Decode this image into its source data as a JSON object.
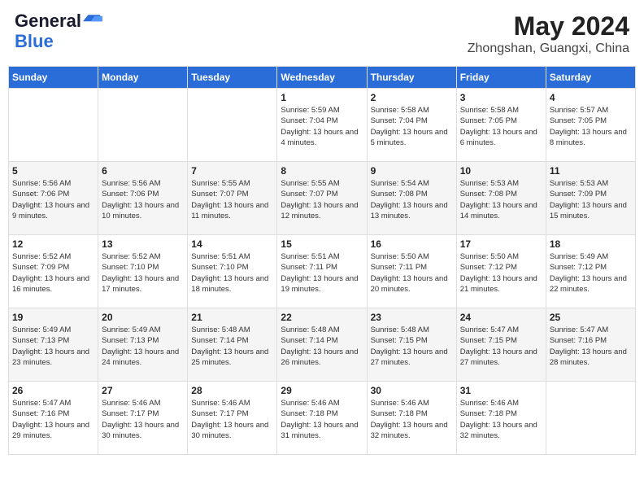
{
  "header": {
    "logo_line1": "General",
    "logo_line2": "Blue",
    "month_year": "May 2024",
    "location": "Zhongshan, Guangxi, China"
  },
  "days_of_week": [
    "Sunday",
    "Monday",
    "Tuesday",
    "Wednesday",
    "Thursday",
    "Friday",
    "Saturday"
  ],
  "weeks": [
    [
      {
        "day": "",
        "sunrise": "",
        "sunset": "",
        "daylight": ""
      },
      {
        "day": "",
        "sunrise": "",
        "sunset": "",
        "daylight": ""
      },
      {
        "day": "",
        "sunrise": "",
        "sunset": "",
        "daylight": ""
      },
      {
        "day": "1",
        "sunrise": "Sunrise: 5:59 AM",
        "sunset": "Sunset: 7:04 PM",
        "daylight": "Daylight: 13 hours and 4 minutes."
      },
      {
        "day": "2",
        "sunrise": "Sunrise: 5:58 AM",
        "sunset": "Sunset: 7:04 PM",
        "daylight": "Daylight: 13 hours and 5 minutes."
      },
      {
        "day": "3",
        "sunrise": "Sunrise: 5:58 AM",
        "sunset": "Sunset: 7:05 PM",
        "daylight": "Daylight: 13 hours and 6 minutes."
      },
      {
        "day": "4",
        "sunrise": "Sunrise: 5:57 AM",
        "sunset": "Sunset: 7:05 PM",
        "daylight": "Daylight: 13 hours and 8 minutes."
      }
    ],
    [
      {
        "day": "5",
        "sunrise": "Sunrise: 5:56 AM",
        "sunset": "Sunset: 7:06 PM",
        "daylight": "Daylight: 13 hours and 9 minutes."
      },
      {
        "day": "6",
        "sunrise": "Sunrise: 5:56 AM",
        "sunset": "Sunset: 7:06 PM",
        "daylight": "Daylight: 13 hours and 10 minutes."
      },
      {
        "day": "7",
        "sunrise": "Sunrise: 5:55 AM",
        "sunset": "Sunset: 7:07 PM",
        "daylight": "Daylight: 13 hours and 11 minutes."
      },
      {
        "day": "8",
        "sunrise": "Sunrise: 5:55 AM",
        "sunset": "Sunset: 7:07 PM",
        "daylight": "Daylight: 13 hours and 12 minutes."
      },
      {
        "day": "9",
        "sunrise": "Sunrise: 5:54 AM",
        "sunset": "Sunset: 7:08 PM",
        "daylight": "Daylight: 13 hours and 13 minutes."
      },
      {
        "day": "10",
        "sunrise": "Sunrise: 5:53 AM",
        "sunset": "Sunset: 7:08 PM",
        "daylight": "Daylight: 13 hours and 14 minutes."
      },
      {
        "day": "11",
        "sunrise": "Sunrise: 5:53 AM",
        "sunset": "Sunset: 7:09 PM",
        "daylight": "Daylight: 13 hours and 15 minutes."
      }
    ],
    [
      {
        "day": "12",
        "sunrise": "Sunrise: 5:52 AM",
        "sunset": "Sunset: 7:09 PM",
        "daylight": "Daylight: 13 hours and 16 minutes."
      },
      {
        "day": "13",
        "sunrise": "Sunrise: 5:52 AM",
        "sunset": "Sunset: 7:10 PM",
        "daylight": "Daylight: 13 hours and 17 minutes."
      },
      {
        "day": "14",
        "sunrise": "Sunrise: 5:51 AM",
        "sunset": "Sunset: 7:10 PM",
        "daylight": "Daylight: 13 hours and 18 minutes."
      },
      {
        "day": "15",
        "sunrise": "Sunrise: 5:51 AM",
        "sunset": "Sunset: 7:11 PM",
        "daylight": "Daylight: 13 hours and 19 minutes."
      },
      {
        "day": "16",
        "sunrise": "Sunrise: 5:50 AM",
        "sunset": "Sunset: 7:11 PM",
        "daylight": "Daylight: 13 hours and 20 minutes."
      },
      {
        "day": "17",
        "sunrise": "Sunrise: 5:50 AM",
        "sunset": "Sunset: 7:12 PM",
        "daylight": "Daylight: 13 hours and 21 minutes."
      },
      {
        "day": "18",
        "sunrise": "Sunrise: 5:49 AM",
        "sunset": "Sunset: 7:12 PM",
        "daylight": "Daylight: 13 hours and 22 minutes."
      }
    ],
    [
      {
        "day": "19",
        "sunrise": "Sunrise: 5:49 AM",
        "sunset": "Sunset: 7:13 PM",
        "daylight": "Daylight: 13 hours and 23 minutes."
      },
      {
        "day": "20",
        "sunrise": "Sunrise: 5:49 AM",
        "sunset": "Sunset: 7:13 PM",
        "daylight": "Daylight: 13 hours and 24 minutes."
      },
      {
        "day": "21",
        "sunrise": "Sunrise: 5:48 AM",
        "sunset": "Sunset: 7:14 PM",
        "daylight": "Daylight: 13 hours and 25 minutes."
      },
      {
        "day": "22",
        "sunrise": "Sunrise: 5:48 AM",
        "sunset": "Sunset: 7:14 PM",
        "daylight": "Daylight: 13 hours and 26 minutes."
      },
      {
        "day": "23",
        "sunrise": "Sunrise: 5:48 AM",
        "sunset": "Sunset: 7:15 PM",
        "daylight": "Daylight: 13 hours and 27 minutes."
      },
      {
        "day": "24",
        "sunrise": "Sunrise: 5:47 AM",
        "sunset": "Sunset: 7:15 PM",
        "daylight": "Daylight: 13 hours and 27 minutes."
      },
      {
        "day": "25",
        "sunrise": "Sunrise: 5:47 AM",
        "sunset": "Sunset: 7:16 PM",
        "daylight": "Daylight: 13 hours and 28 minutes."
      }
    ],
    [
      {
        "day": "26",
        "sunrise": "Sunrise: 5:47 AM",
        "sunset": "Sunset: 7:16 PM",
        "daylight": "Daylight: 13 hours and 29 minutes."
      },
      {
        "day": "27",
        "sunrise": "Sunrise: 5:46 AM",
        "sunset": "Sunset: 7:17 PM",
        "daylight": "Daylight: 13 hours and 30 minutes."
      },
      {
        "day": "28",
        "sunrise": "Sunrise: 5:46 AM",
        "sunset": "Sunset: 7:17 PM",
        "daylight": "Daylight: 13 hours and 30 minutes."
      },
      {
        "day": "29",
        "sunrise": "Sunrise: 5:46 AM",
        "sunset": "Sunset: 7:18 PM",
        "daylight": "Daylight: 13 hours and 31 minutes."
      },
      {
        "day": "30",
        "sunrise": "Sunrise: 5:46 AM",
        "sunset": "Sunset: 7:18 PM",
        "daylight": "Daylight: 13 hours and 32 minutes."
      },
      {
        "day": "31",
        "sunrise": "Sunrise: 5:46 AM",
        "sunset": "Sunset: 7:18 PM",
        "daylight": "Daylight: 13 hours and 32 minutes."
      },
      {
        "day": "",
        "sunrise": "",
        "sunset": "",
        "daylight": ""
      }
    ]
  ]
}
